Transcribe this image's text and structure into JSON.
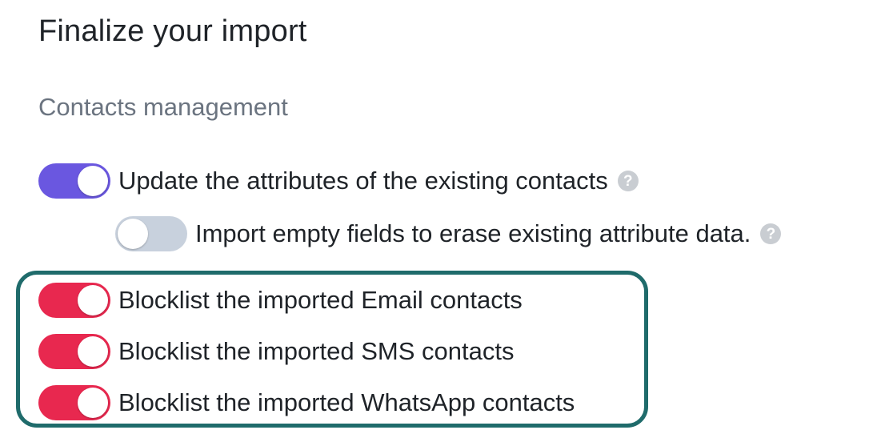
{
  "title": "Finalize your import",
  "section_heading": "Contacts management",
  "help_glyph": "?",
  "colors": {
    "toggle_on_primary": "#6a57e0",
    "toggle_off": "#c8d1dd",
    "toggle_on_danger": "#e8284f",
    "highlight_border": "#1f6b6b"
  },
  "options": [
    {
      "label": "Update the attributes of the existing contacts",
      "enabled": true,
      "has_help": true,
      "icon": "help-icon"
    },
    {
      "label": "Import empty fields to erase existing attribute data.",
      "enabled": false,
      "has_help": true,
      "icon": "help-icon"
    },
    {
      "label": "Blocklist the imported Email contacts",
      "enabled": true,
      "has_help": false
    },
    {
      "label": "Blocklist the imported SMS contacts",
      "enabled": true,
      "has_help": false
    },
    {
      "label": "Blocklist the imported WhatsApp contacts",
      "enabled": true,
      "has_help": false
    }
  ]
}
